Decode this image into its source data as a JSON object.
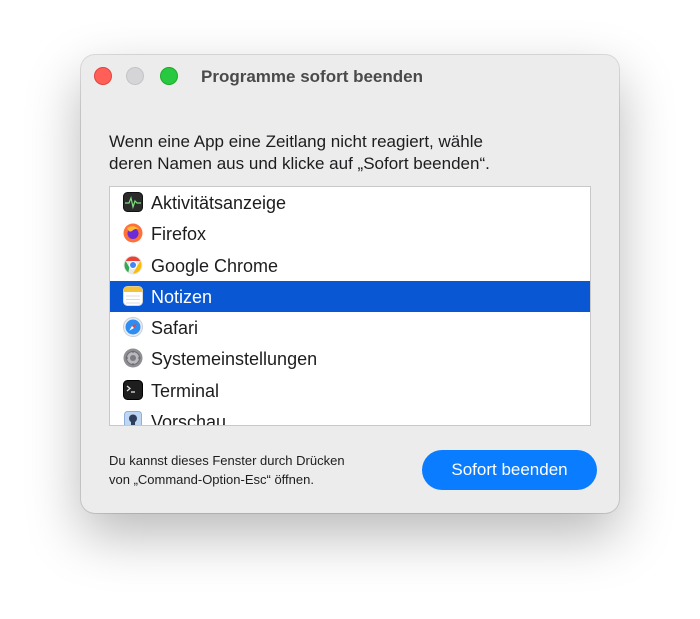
{
  "window": {
    "title": "Programme sofort beenden"
  },
  "instructions": {
    "line1": "Wenn eine App eine Zeitlang nicht reagiert, wähle",
    "line2": "deren Namen aus und klicke auf „Sofort beenden“."
  },
  "apps": [
    {
      "label": "Aktivitätsanzeige",
      "icon": "activity-monitor-icon"
    },
    {
      "label": "Firefox",
      "icon": "firefox-icon"
    },
    {
      "label": "Google Chrome",
      "icon": "chrome-icon"
    },
    {
      "label": "Notizen",
      "icon": "notes-icon",
      "selected": true
    },
    {
      "label": "Safari",
      "icon": "safari-icon"
    },
    {
      "label": "Systemeinstellungen",
      "icon": "system-settings-icon"
    },
    {
      "label": "Terminal",
      "icon": "terminal-icon"
    },
    {
      "label": "Vorschau",
      "icon": "preview-icon"
    }
  ],
  "footer": {
    "hint_line1": "Du kannst dieses Fenster durch Drücken",
    "hint_line2": "von „Command-Option-Esc“ öffnen.",
    "button_label": "Sofort beenden"
  },
  "colors": {
    "accent_button": "#0a7cff",
    "selection": "#0a57d4",
    "close": "#ff5f57",
    "zoom": "#28c840"
  }
}
